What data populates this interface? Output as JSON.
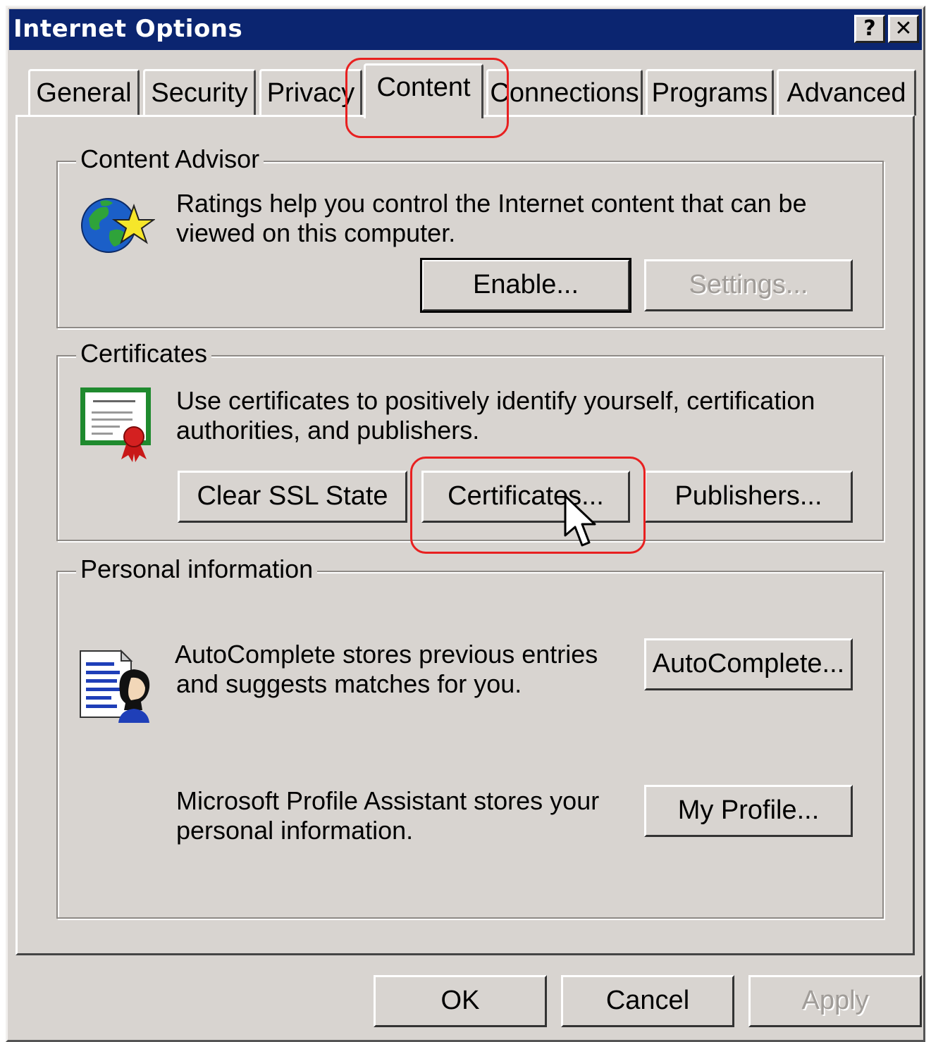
{
  "window": {
    "title": "Internet Options",
    "help_glyph": "?",
    "close_glyph": "✕"
  },
  "tabs": [
    {
      "label": "General"
    },
    {
      "label": "Security"
    },
    {
      "label": "Privacy"
    },
    {
      "label": "Content",
      "active": true
    },
    {
      "label": "Connections"
    },
    {
      "label": "Programs"
    },
    {
      "label": "Advanced"
    }
  ],
  "content_advisor": {
    "label": "Content Advisor",
    "icon": "globe-star-icon",
    "description_line1": "Ratings help you control the Internet content that can be",
    "description_line2": "viewed on this computer.",
    "enable_button": "Enable...",
    "settings_button": "Settings..."
  },
  "certificates": {
    "label": "Certificates",
    "icon": "certificate-icon",
    "description_line1": "Use certificates to positively identify yourself, certification",
    "description_line2": "authorities, and publishers.",
    "clear_ssl_button": "Clear SSL State",
    "certificates_button": "Certificates...",
    "publishers_button": "Publishers..."
  },
  "personal_information": {
    "label": "Personal information",
    "icon": "autocomplete-profile-icon",
    "autocomplete_line1": "AutoComplete stores previous entries",
    "autocomplete_line2": "and suggests matches for you.",
    "autocomplete_button": "AutoComplete...",
    "profile_line1": "Microsoft Profile Assistant stores your",
    "profile_line2": "personal information.",
    "profile_button": "My Profile..."
  },
  "footer": {
    "ok_button": "OK",
    "cancel_button": "Cancel",
    "apply_button": "Apply"
  },
  "colors": {
    "title_bar": "#0b2570",
    "dialog_face": "#d8d4d0",
    "annotation": "#e82020"
  }
}
